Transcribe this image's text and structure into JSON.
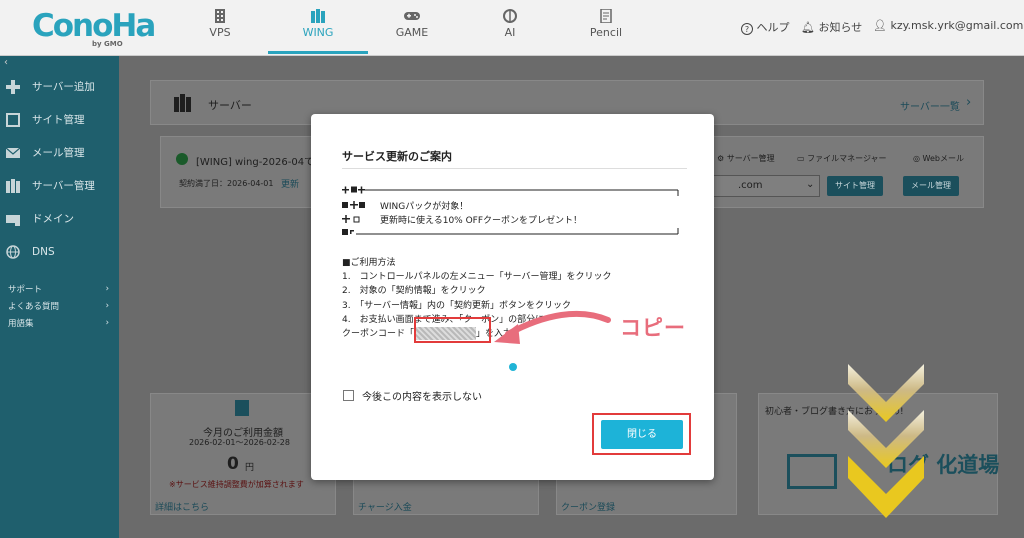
{
  "header": {
    "logo": "ConoHa",
    "logo_sub": "by GMO",
    "tabs": [
      {
        "label": "VPS",
        "icon": "server-grid-icon",
        "active": false
      },
      {
        "label": "WING",
        "icon": "server-rack-icon",
        "active": true
      },
      {
        "label": "GAME",
        "icon": "gamepad-icon",
        "active": false
      },
      {
        "label": "AI",
        "icon": "brain-icon",
        "active": false
      },
      {
        "label": "Pencil",
        "icon": "pencil-doc-icon",
        "active": false
      }
    ],
    "help": "ヘルプ",
    "notifications": "お知らせ",
    "account": "kzy.msk.yrk@gmail.com"
  },
  "sidebar": {
    "collapse": "‹",
    "items": [
      {
        "label": "サーバー追加",
        "icon": "plus-icon"
      },
      {
        "label": "サイト管理",
        "icon": "window-icon"
      },
      {
        "label": "メール管理",
        "icon": "mail-icon"
      },
      {
        "label": "サーバー管理",
        "icon": "server-icon"
      },
      {
        "label": "ドメイン",
        "icon": "domain-icon"
      },
      {
        "label": "DNS",
        "icon": "globe-icon"
      }
    ],
    "sub_items": [
      "サポート",
      "よくある質問",
      "用語集"
    ]
  },
  "main": {
    "server_section_title": "サーバー",
    "server_list_link": "サーバー一覧",
    "server_name": "[WING] wing-2026-04で",
    "contract_end": "契約満了日：2026-04-01",
    "update_link": "更新",
    "actions": [
      "サーバー管理",
      "ファイルマネージャー",
      "Webメール"
    ],
    "domain_suffix": ".com",
    "site_btn": "サイト管理",
    "mail_btn": "メール管理",
    "usage_title": "今月のご利用金額",
    "usage_period": "2026-02-01〜2026-02-28",
    "usage_amount": "0",
    "usage_unit": "円",
    "usage_note": "※サービス維持調整費が加算されます",
    "details_link": "詳細はこちら",
    "charge_link": "チャージ入金",
    "coupon_link": "クーポン登録",
    "promo_title": "初心者・ブログ書き方におすすめ!",
    "promo_text": "ログ 化道場"
  },
  "modal": {
    "title": "サービス更新のご案内",
    "banner_line1": "WINGパックが対象！",
    "banner_line2": "更新時に使える10% OFFクーポンをプレゼント！",
    "usage_heading": "■ご利用方法",
    "steps": [
      "1.　コントロールパネルの左メニュー「サーバー管理」をクリック",
      "2.　対象の「契約情報」をクリック",
      "3.　「サーバー情報」内の「契約更新」ボタンをクリック",
      "4.　お支払い画面まで進み、「クーポン」の部分に"
    ],
    "coupon_prefix": "クーポンコード「",
    "coupon_suffix": "」を入力",
    "dont_show": "今後この内容を表示しない",
    "close_label": "閉じる"
  },
  "annotation": {
    "copy_label": "コピー",
    "accent_color": "#e23b3b",
    "arrow_color": "#e86d7c",
    "chevron_color": "#e8c52a"
  }
}
